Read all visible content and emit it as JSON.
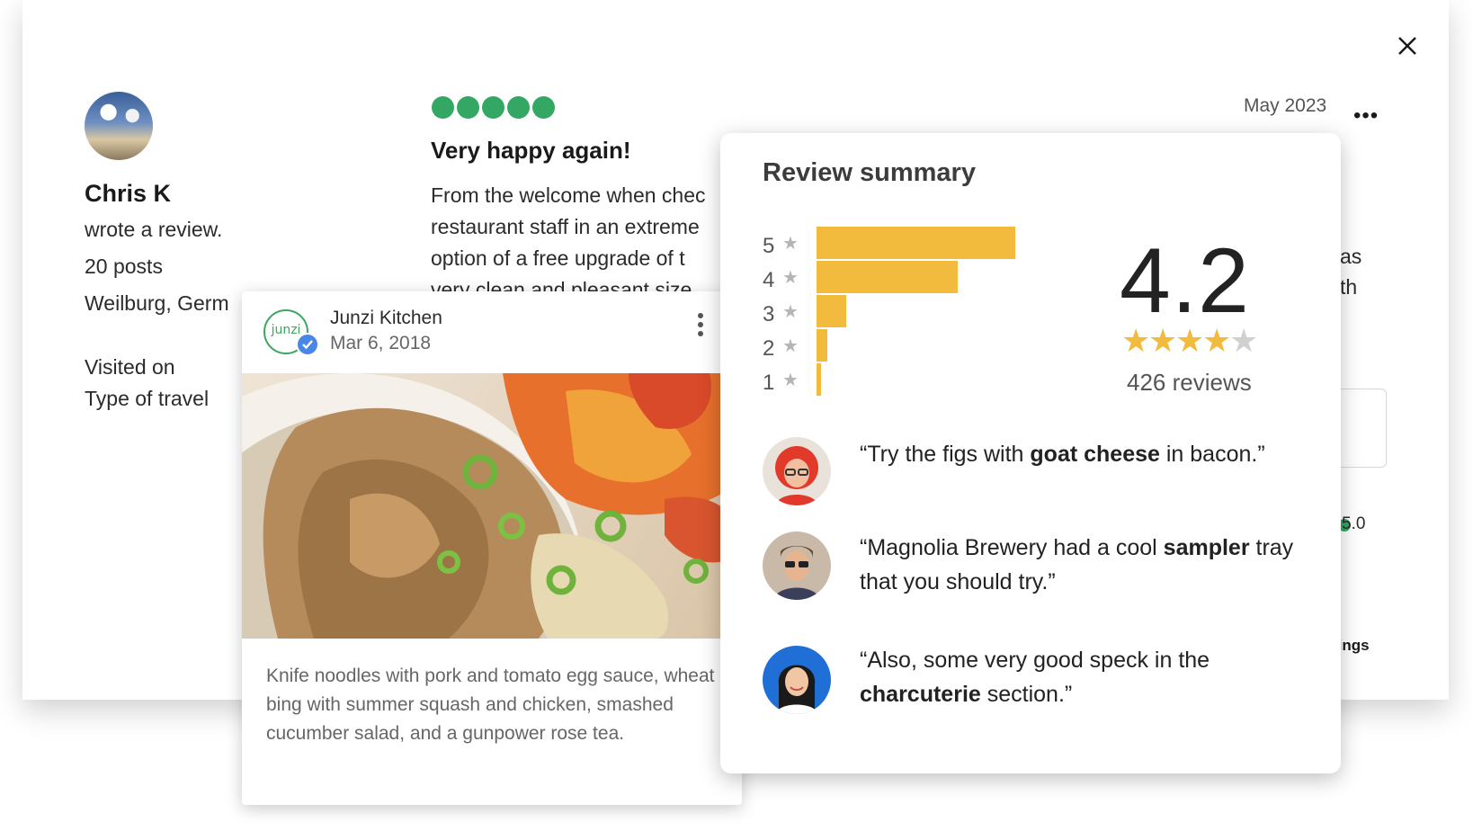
{
  "review": {
    "reviewer_name": "Chris K",
    "action": "wrote a review.",
    "posts": "20 posts",
    "location": "Weilburg, Germ",
    "visited_label": "Visited on",
    "travel_label": "Type of travel",
    "rating": 5,
    "title": "Very happy again!",
    "body_lines": [
      "From the welcome when chec",
      "restaurant staff in an extreme",
      "option of a free upgrade of t",
      "very clean and pleasant size"
    ],
    "date": "May 2023",
    "more_label": "•••",
    "edge_text_1": "as",
    "edge_text_2": "th",
    "edge_rating": "5.0",
    "edge_link": "tings"
  },
  "food_card": {
    "business_name": "Junzi Kitchen",
    "logo_text": "junzi",
    "date": "Mar 6, 2018",
    "caption": "Knife noodles with pork and tomato egg sauce, wheat bing with summer squash and chicken, smashed cucumber salad, and a gunpower rose tea."
  },
  "summary": {
    "title": "Review summary",
    "histogram": [
      {
        "stars": "5",
        "share": 0.94
      },
      {
        "stars": "4",
        "share": 0.67
      },
      {
        "stars": "3",
        "share": 0.14
      },
      {
        "stars": "2",
        "share": 0.05
      },
      {
        "stars": "1",
        "share": 0.02
      }
    ],
    "average": "4.2",
    "star_rating": 4,
    "review_count": "426 reviews",
    "quotes": [
      {
        "before": "“Try the figs with ",
        "bold": "goat cheese",
        "after": " in bacon.”"
      },
      {
        "before": "“Magnolia Brewery had a cool ",
        "bold": "sampler",
        "after": " tray that you should try.”"
      },
      {
        "before": "“Also, some very good speck in the ",
        "bold": "charcuterie",
        "after": " section.”"
      }
    ]
  },
  "colors": {
    "rating_green": "#34a764",
    "bar_yellow": "#f2bb3e",
    "star_gold": "#f2bb3e",
    "star_grey": "#d0d0d0",
    "verified_blue": "#4a86e8"
  }
}
